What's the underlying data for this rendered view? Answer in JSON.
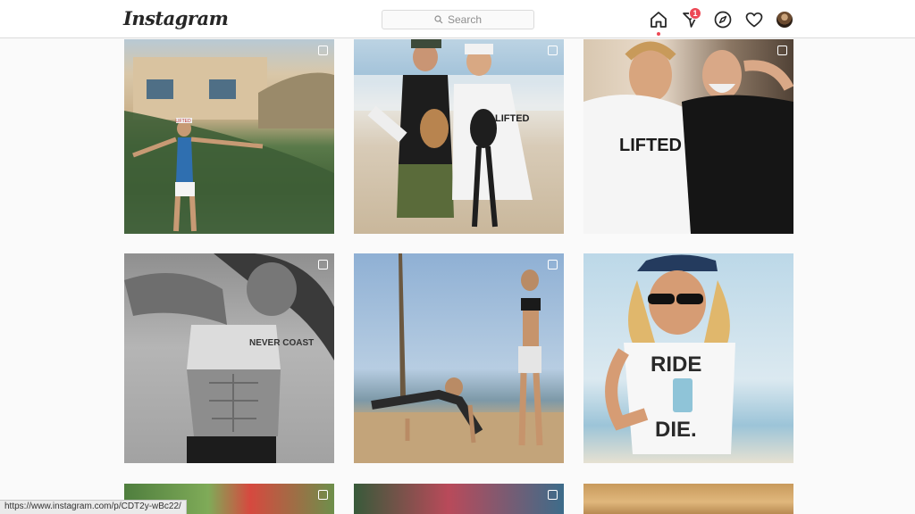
{
  "header": {
    "logo": "Instagram",
    "search_placeholder": "Search",
    "notification_count": "1"
  },
  "icons": {
    "home": "home-icon",
    "direct": "paper-plane-icon",
    "explore": "compass-icon",
    "activity": "heart-icon",
    "profile": "avatar"
  },
  "colors": {
    "badge": "#ed4956",
    "border": "#dbdbdb",
    "background": "#fafafa"
  },
  "grid": {
    "rows": [
      {
        "posts": [
          {
            "caption": "",
            "multi": true
          },
          {
            "caption": "",
            "multi": true
          },
          {
            "caption": "",
            "multi": true
          }
        ]
      },
      {
        "posts": [
          {
            "caption": "",
            "multi": true
          },
          {
            "caption": "",
            "multi": true
          },
          {
            "caption": "",
            "multi": false
          }
        ]
      },
      {
        "posts": [
          {
            "caption": "",
            "multi": true
          },
          {
            "caption": "",
            "multi": true
          },
          {
            "caption": "",
            "multi": false
          }
        ]
      }
    ],
    "shirt_texts": {
      "lifted_cap": "LIFTED",
      "lifted_hoodie_1": "LIFTED",
      "lifted_hoodie_2": "LIFTED",
      "never_coast": "NEVER COAST",
      "ride_or_die_1": "RIDE",
      "ride_or_die_2": "DIE."
    }
  },
  "status_bar": {
    "url": "https://www.instagram.com/p/CDT2y-wBc22/"
  }
}
